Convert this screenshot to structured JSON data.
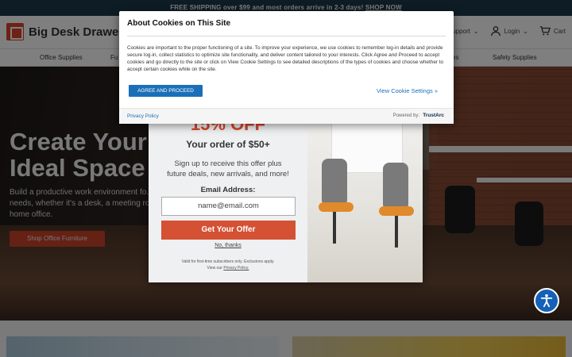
{
  "promo_bar": {
    "text": "FREE SHIPPING over $99 and most orders arrive in 2-3 days!",
    "link": "SHOP NOW"
  },
  "header": {
    "logo": "Big Desk Drawer",
    "support": "Support",
    "login": "Login",
    "cart": "Cart"
  },
  "nav": {
    "items": [
      "Office Supplies",
      "Fu",
      "es",
      "Safety Supplies"
    ]
  },
  "hero": {
    "title": "Create Your Ideal Space",
    "subtitle": "Build a productive work environment fo... needs, whether it's a desk, a meeting ro... home office.",
    "button": "Shop Office Furniture"
  },
  "promo_modal": {
    "discount": "15% OFF",
    "order_line": "Your order of $50+",
    "signup_text": "Sign up to receive this offer plus future deals, new arrivals, and more!",
    "email_label": "Email Address:",
    "email_placeholder": "name@email.com",
    "cta": "Get Your Offer",
    "no_thanks": "No, thanks",
    "fine_print": "Valid for first-time subscribers only. Exclusions apply.",
    "fine_print_view": "View our",
    "fine_print_link": "Privacy Policy."
  },
  "cookie_dialog": {
    "title": "About Cookies on This Site",
    "body": "Cookies are important to the proper functioning of a site. To improve your experience, we use cookies to remember log-in details and provide secure log-in, collect statistics to optimize site functionality, and deliver content tailored to your interests. Click Agree and Proceed to accept cookies and go directly to the site or click on View Cookie Settings to see detailed descriptions of the types of cookies and choose whether to accept certain cookies while on the site.",
    "agree_button": "AGREE AND PROCEED",
    "settings_link": "View Cookie Settings »",
    "privacy_link": "Privacy Policy",
    "powered_by": "Powered by:",
    "provider": "TrustArc"
  },
  "colors": {
    "brand": "#d9442a",
    "cookie_accent": "#1b6fb8",
    "a11y": "#1561b8"
  }
}
